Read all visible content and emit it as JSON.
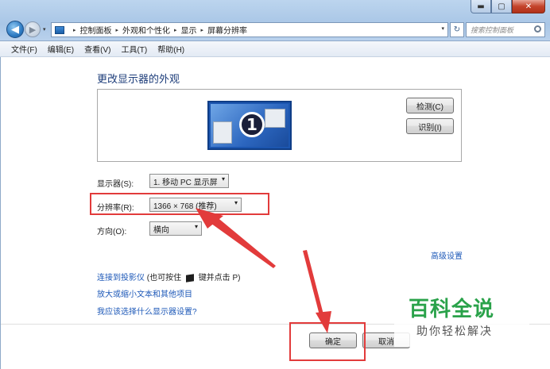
{
  "window": {
    "minimize_glyph": "▬",
    "maximize_glyph": "▢",
    "close_glyph": "✕"
  },
  "nav": {
    "back_glyph": "◀",
    "forward_glyph": "▶",
    "dropdown_glyph": "▾"
  },
  "address": {
    "crumbs": [
      "控制面板",
      "外观和个性化",
      "显示",
      "屏幕分辨率"
    ],
    "separator": "▸",
    "refresh_glyph": "↻"
  },
  "search": {
    "placeholder": "搜索控制面板"
  },
  "menu": {
    "items": [
      "文件(F)",
      "编辑(E)",
      "查看(V)",
      "工具(T)",
      "帮助(H)"
    ]
  },
  "page": {
    "title": "更改显示器的外观"
  },
  "preview": {
    "monitor_number": "1",
    "detect_label": "检测(C)",
    "identify_label": "识别(I)"
  },
  "settings": {
    "display_label": "显示器(S):",
    "display_value": "1. 移动 PC 显示屏",
    "resolution_label": "分辨率(R):",
    "resolution_value": "1366 × 768 (推荐)",
    "orientation_label": "方向(O):",
    "orientation_value": "横向"
  },
  "links": {
    "advanced": "高级设置",
    "projector": "连接到投影仪",
    "projector_hint_before": "(也可按住",
    "projector_hint_after": "键并点击 P)",
    "text_size": "放大或缩小文本和其他项目",
    "which_settings": "我应该选择什么显示器设置?"
  },
  "footer": {
    "ok_label": "确定",
    "cancel_label": "取消"
  },
  "watermark": {
    "title": "百科全说",
    "subtitle": "助你轻松解决"
  },
  "colors": {
    "annotation_red": "#e23b3b",
    "link_blue": "#1e59b8",
    "title_blue": "#1d3d7a",
    "watermark_green": "#2aa24a"
  }
}
